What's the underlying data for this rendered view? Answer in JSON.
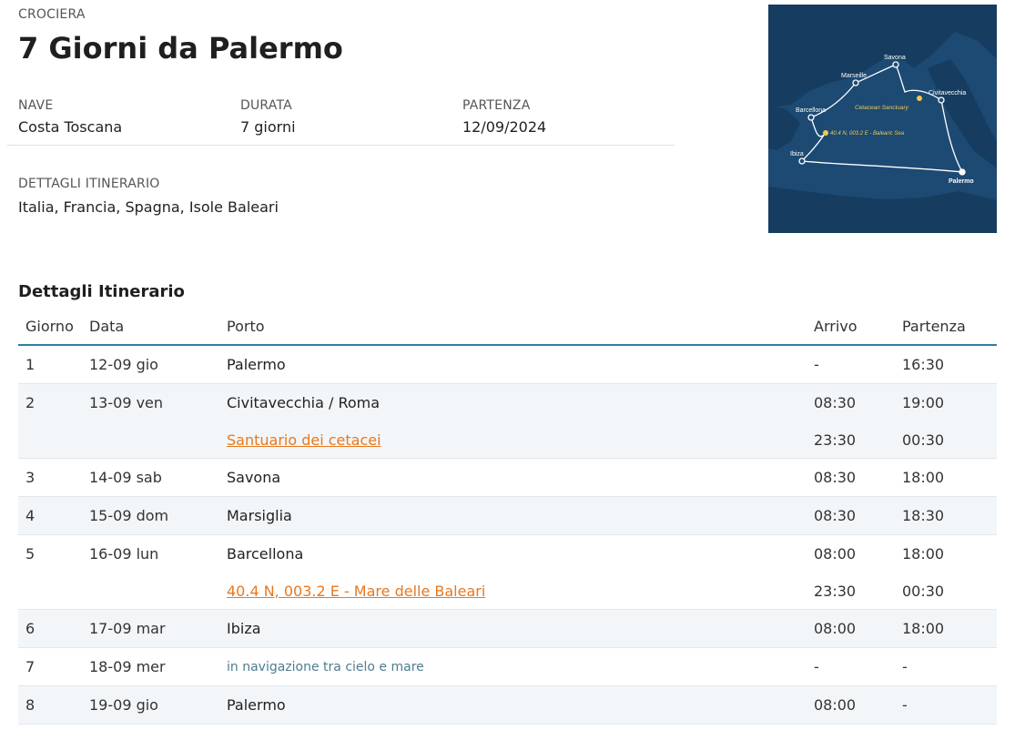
{
  "header": {
    "kicker": "CROCIERA",
    "title": "7 Giorni da Palermo"
  },
  "meta": {
    "nave_label": "NAVE",
    "nave_value": "Costa Toscana",
    "durata_label": "DURATA",
    "durata_value": "7 giorni",
    "partenza_label": "PARTENZA",
    "partenza_value": "12/09/2024"
  },
  "itinerary_summary": {
    "label": "DETTAGLI ITINERARIO",
    "value": "Italia, Francia, Spagna, Isole Baleari"
  },
  "map": {
    "ports": [
      "Savona",
      "Marseille",
      "Civitavecchia",
      "Barcellona",
      "Ibiza",
      "Palermo"
    ],
    "notes": [
      "Cetacean Sanctuary",
      "40.4 N, 003.2 E - Balearic Sea"
    ],
    "colors": {
      "sea": "#1c4a73",
      "route": "#ffffff",
      "note": "#f2c94c"
    }
  },
  "section_title": "Dettagli Itinerario",
  "table": {
    "headers": [
      "Giorno",
      "Data",
      "Porto",
      "Arrivo",
      "Partenza"
    ],
    "rows": [
      {
        "giorno": "1",
        "data": "12-09 gio",
        "lines": [
          {
            "porto": "Palermo",
            "arrivo": "-",
            "partenza": "16:30"
          }
        ]
      },
      {
        "giorno": "2",
        "data": "13-09 ven",
        "lines": [
          {
            "porto": "Civitavecchia / Roma",
            "arrivo": "08:30",
            "partenza": "19:00"
          },
          {
            "porto": "Santuario dei cetacei",
            "arrivo": "23:30",
            "partenza": "00:30"
          }
        ]
      },
      {
        "giorno": "3",
        "data": "14-09 sab",
        "lines": [
          {
            "porto": "Savona",
            "arrivo": "08:30",
            "partenza": "18:00"
          }
        ]
      },
      {
        "giorno": "4",
        "data": "15-09 dom",
        "lines": [
          {
            "porto": "Marsiglia",
            "arrivo": "08:30",
            "partenza": "18:30"
          }
        ]
      },
      {
        "giorno": "5",
        "data": "16-09 lun",
        "lines": [
          {
            "porto": "Barcellona",
            "arrivo": "08:00",
            "partenza": "18:00"
          },
          {
            "porto": "40.4 N, 003.2 E - Mare delle Baleari",
            "arrivo": "23:30",
            "partenza": "00:30"
          }
        ]
      },
      {
        "giorno": "6",
        "data": "17-09 mar",
        "lines": [
          {
            "porto": "Ibiza",
            "arrivo": "08:00",
            "partenza": "18:00"
          }
        ]
      },
      {
        "giorno": "7",
        "data": "18-09 mer",
        "lines": [
          {
            "porto": "in navigazione tra cielo e mare",
            "arrivo": "-",
            "partenza": "-"
          }
        ]
      },
      {
        "giorno": "8",
        "data": "19-09 gio",
        "lines": [
          {
            "porto": "Palermo",
            "arrivo": "08:00",
            "partenza": "-"
          }
        ]
      }
    ]
  },
  "colors": {
    "accent_link": "#e8781e",
    "header_rule": "#2f7fa0",
    "row_alt": "#f3f6f9",
    "nav_text": "#4e7d91"
  }
}
